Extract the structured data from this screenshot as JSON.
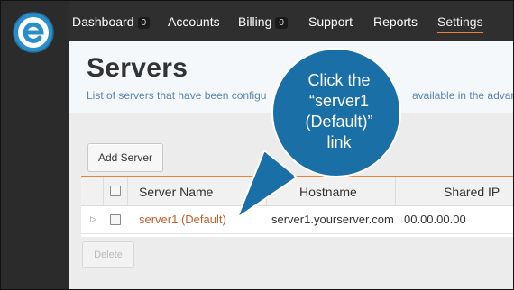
{
  "nav": {
    "items": [
      {
        "label": "Dashboard",
        "badge": "0"
      },
      {
        "label": "Accounts"
      },
      {
        "label": "Billing",
        "badge": "0"
      },
      {
        "label": "Support"
      },
      {
        "label": "Reports"
      },
      {
        "label": "Settings",
        "active": true
      }
    ]
  },
  "page": {
    "title": "Servers",
    "description": "List of servers that have been configu",
    "description_tail": "available in the advan"
  },
  "toolbar": {
    "add_label": "Add Server",
    "delete_label": "Delete"
  },
  "table": {
    "columns": [
      "Server Name",
      "Hostname",
      "Shared IP"
    ],
    "rows": [
      {
        "name": "server1 (Default)",
        "hostname": "server1.yourserver.com",
        "shared_ip": "00.00.00.00"
      }
    ]
  },
  "callout": {
    "lines": [
      "Click the",
      "“server1",
      "(Default)”",
      "link"
    ],
    "color": "#1a6fa6"
  },
  "colors": {
    "accent": "#e8833a",
    "link": "#c0602a",
    "logo_blue": "#2a8fc9"
  }
}
